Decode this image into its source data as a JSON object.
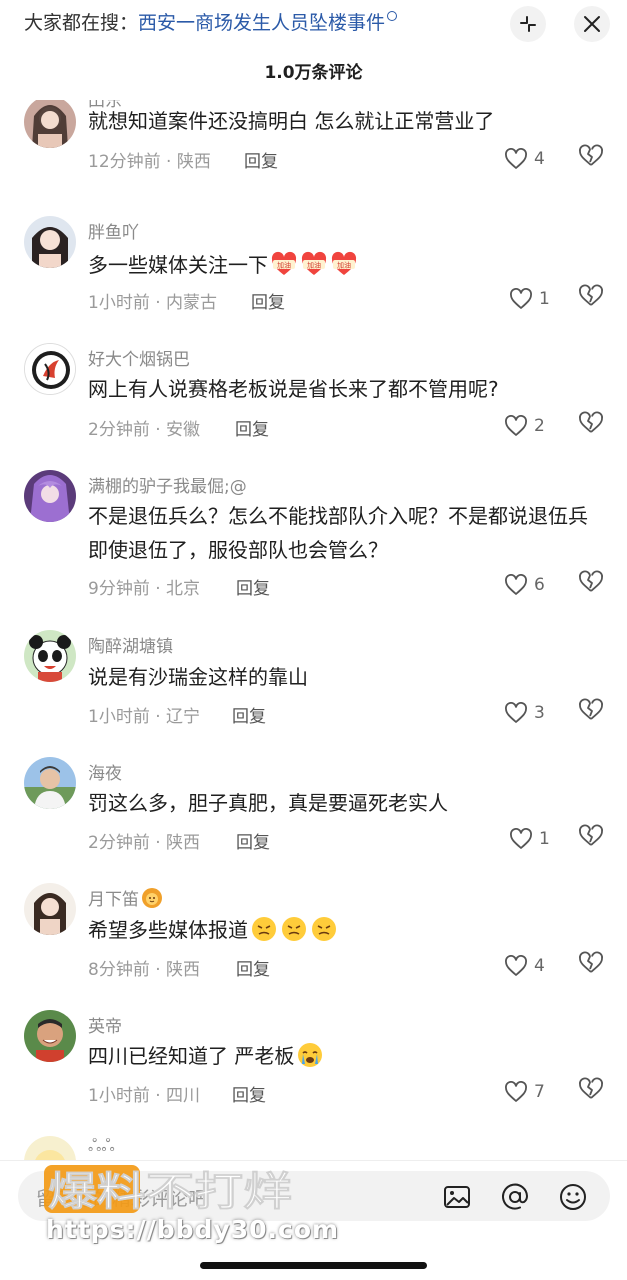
{
  "top": {
    "search_prefix": "大家都在搜：",
    "search_topic": "西安一商场发生人员坠楼事件",
    "comment_count": "1.0万条评论"
  },
  "comments": [
    {
      "username": "田东",
      "text": "就想知道案件还没搞明白  怎么就让正常营业了",
      "time": "12分钟前",
      "location": "陕西",
      "reply": "回复",
      "likes": "4"
    },
    {
      "username": "胖鱼吖",
      "text": "多一些媒体关注一下",
      "time": "1小时前",
      "location": "内蒙古",
      "reply": "回复",
      "likes": "1",
      "emoji": [
        "加油",
        "加油",
        "加油"
      ]
    },
    {
      "username": "好大个烟锅巴",
      "text": "网上有人说赛格老板说是省长来了都不管用呢?",
      "time": "2分钟前",
      "location": "安徽",
      "reply": "回复",
      "likes": "2"
    },
    {
      "username": "满棚的驴子我最倔;@",
      "text": "不是退伍兵么？怎么不能找部队介入呢？不是都说退伍兵即使退伍了，服役部队也会管么？",
      "time": "9分钟前",
      "location": "北京",
      "reply": "回复",
      "likes": "6"
    },
    {
      "username": "陶醉湖塘镇",
      "text": "说是有沙瑞金这样的靠山",
      "time": "1小时前",
      "location": "辽宁",
      "reply": "回复",
      "likes": "3"
    },
    {
      "username": "海夜",
      "text": "罚这么多，胆子真肥，真是要逼死老实人",
      "time": "2分钟前",
      "location": "陕西",
      "reply": "回复",
      "likes": "1"
    },
    {
      "username": "月下笛",
      "text": "希望多些媒体报道",
      "time": "8分钟前",
      "location": "陕西",
      "reply": "回复",
      "likes": "4"
    },
    {
      "username": "英帝",
      "text": "四川已经知道了 严老板",
      "time": "1小时前",
      "location": "四川",
      "reply": "回复",
      "likes": "7"
    },
    {
      "username": "ஃஃ"
    }
  ],
  "bottom": {
    "placeholder": "留下你的精彩评论吧",
    "watermark_logo_text": "爆料不打烊",
    "watermark_url": "https://bbdy30.com"
  },
  "colors": {
    "accent_link": "#2b5aa8",
    "watermark_orange": "#f39a16"
  }
}
